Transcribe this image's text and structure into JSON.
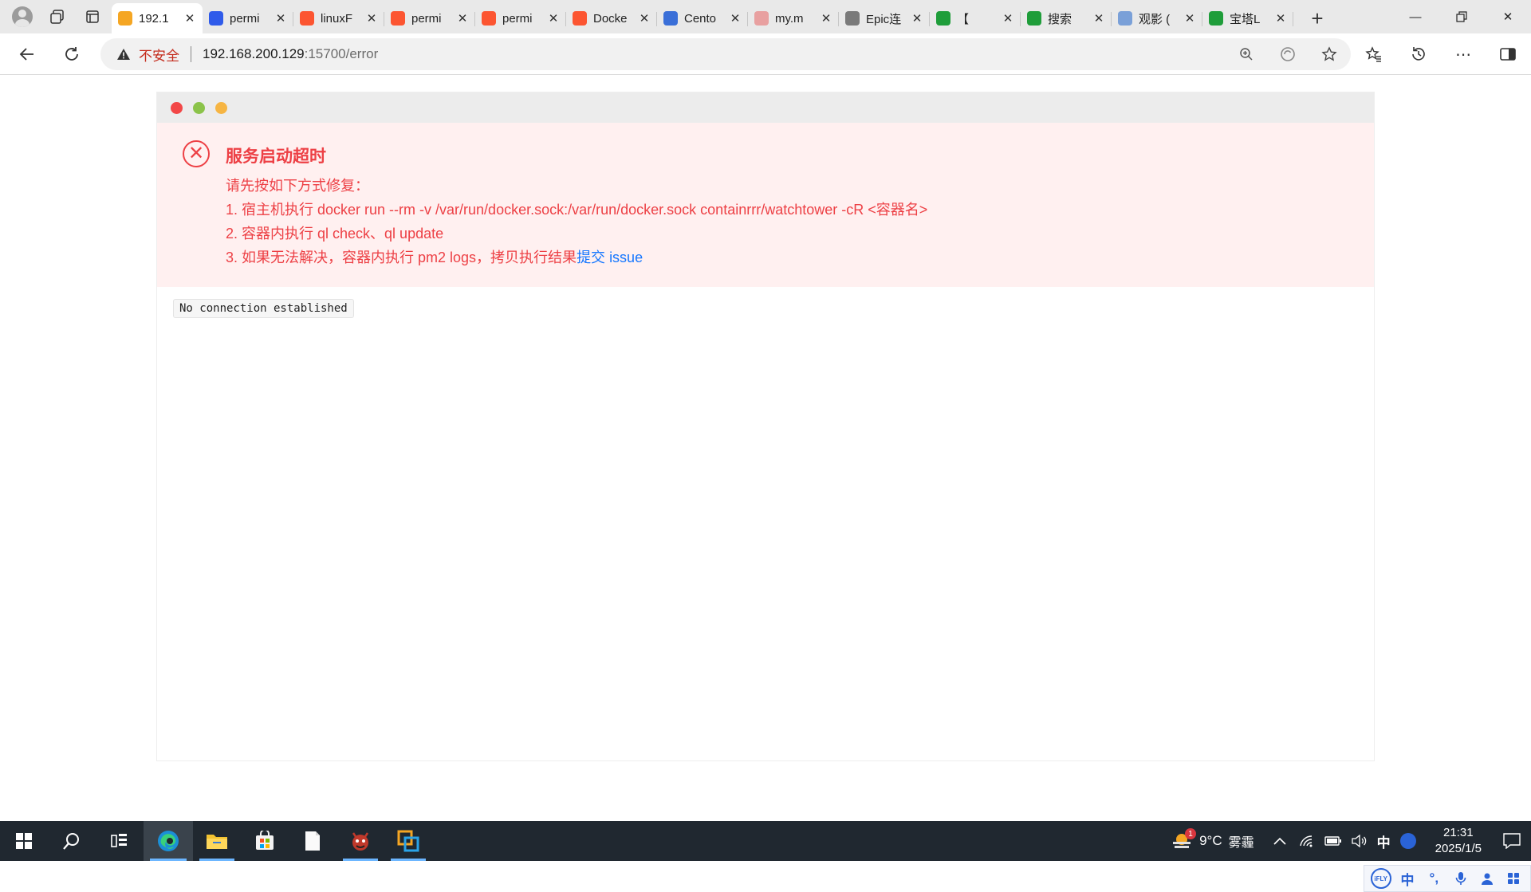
{
  "browser": {
    "tabs": [
      {
        "title": "192.1",
        "favicon": "cat-icon",
        "color": "#f5a623",
        "active": true
      },
      {
        "title": "permi",
        "favicon": "paw-icon",
        "color": "#2f5bea"
      },
      {
        "title": "linuxF",
        "favicon": "c-icon",
        "color": "#fc5531"
      },
      {
        "title": "permi",
        "favicon": "c-icon",
        "color": "#fc5531"
      },
      {
        "title": "permi",
        "favicon": "c-icon",
        "color": "#fc5531"
      },
      {
        "title": "Docke",
        "favicon": "c-icon",
        "color": "#fc5531"
      },
      {
        "title": "Cento",
        "favicon": "globe-icon",
        "color": "#3a6fd8"
      },
      {
        "title": "my.m",
        "favicon": "doc-icon",
        "color": "#e8a0a0"
      },
      {
        "title": "Epic连",
        "favicon": "page-icon",
        "color": "#7a7a7a"
      },
      {
        "title": "【",
        "favicon": "shield-icon",
        "color": "#1f9d3a"
      },
      {
        "title": "搜索",
        "favicon": "shield-icon",
        "color": "#1f9d3a"
      },
      {
        "title": "观影 (",
        "favicon": "play-icon",
        "color": "#7aa0d8"
      },
      {
        "title": "宝塔L",
        "favicon": "shield-icon",
        "color": "#1f9d3a"
      }
    ],
    "address": {
      "security_label": "不安全",
      "host": "192.168.200.129",
      "path": ":15700/error"
    }
  },
  "app": {
    "error_title": "服务启动超时",
    "intro": "请先按如下方式修复：",
    "step1": "1. 宿主机执行 docker run --rm -v /var/run/docker.sock:/var/run/docker.sock containrrr/watchtower -cR <容器名>",
    "step2": "2. 容器内执行 ql check、ql update",
    "step3_prefix": "3. 如果无法解决，容器内执行 pm2 logs，拷贝执行结果",
    "step3_link": "提交 issue",
    "log_text": "No connection established"
  },
  "ime": {
    "logo": "iFLY",
    "mode": "中"
  },
  "taskbar": {
    "weather_temp": "9°C",
    "weather_desc": "雾霾",
    "weather_badge": "1",
    "input_lang": "中",
    "time": "21:31",
    "date": "2025/1/5"
  }
}
